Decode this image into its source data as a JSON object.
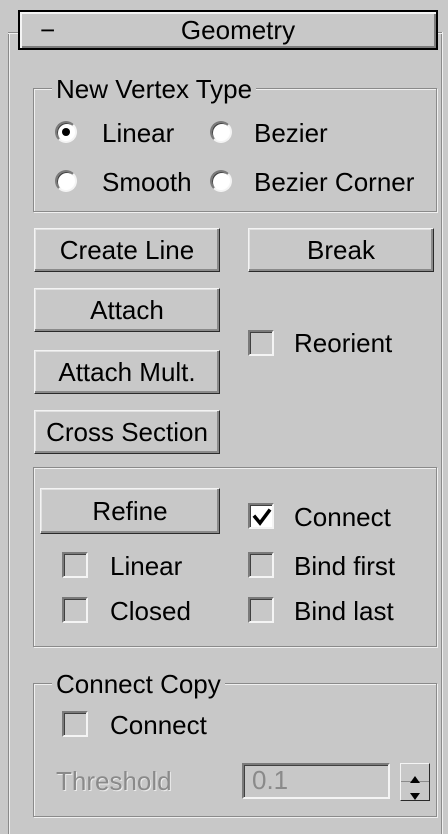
{
  "rollout": {
    "collapse_symbol": "−",
    "title": "Geometry"
  },
  "new_vertex_type": {
    "label": "New Vertex Type",
    "options": [
      {
        "label": "Linear",
        "selected": true
      },
      {
        "label": "Bezier",
        "selected": false
      },
      {
        "label": "Smooth",
        "selected": false
      },
      {
        "label": "Bezier Corner",
        "selected": false
      }
    ]
  },
  "buttons": {
    "create_line": "Create Line",
    "break": "Break",
    "attach": "Attach",
    "attach_mult": "Attach Mult.",
    "cross_section": "Cross Section",
    "refine": "Refine"
  },
  "reorient": {
    "label": "Reorient",
    "checked": false
  },
  "refine_options": {
    "connect": {
      "label": "Connect",
      "checked": true
    },
    "linear": {
      "label": "Linear",
      "checked": false
    },
    "bind_first": {
      "label": "Bind first",
      "checked": false
    },
    "closed": {
      "label": "Closed",
      "checked": false
    },
    "bind_last": {
      "label": "Bind last",
      "checked": false
    }
  },
  "connect_copy": {
    "label": "Connect Copy",
    "connect": {
      "label": "Connect",
      "checked": false
    },
    "threshold_label": "Threshold",
    "threshold_value": "0.1"
  }
}
